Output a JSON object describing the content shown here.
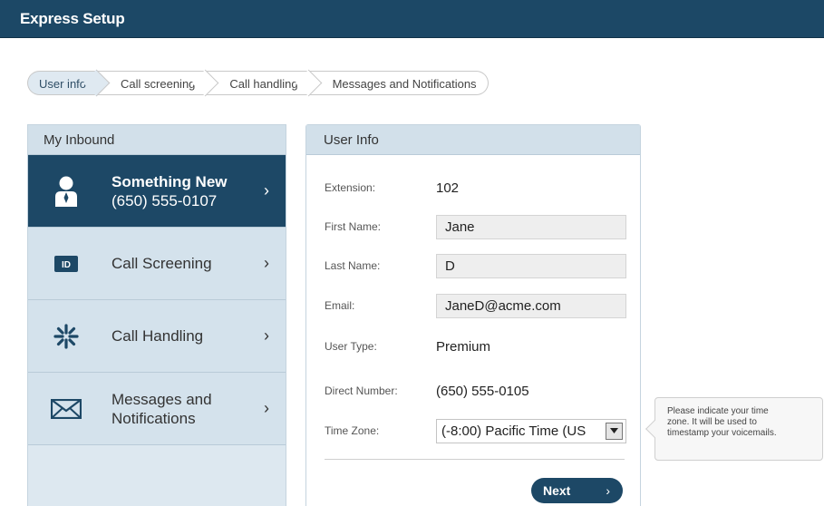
{
  "window": {
    "title": "Express Setup"
  },
  "breadcrumb": [
    {
      "label": "User info"
    },
    {
      "label": "Call screening"
    },
    {
      "label": "Call handling"
    },
    {
      "label": "Messages and Notifications"
    }
  ],
  "sidebar": {
    "title": "My Inbound",
    "items": [
      {
        "line1": "Something New",
        "line2": "(650) 555-0107",
        "icon": "user-icon",
        "active": true
      },
      {
        "line1": "Call Screening",
        "line2": "",
        "icon": "id-badge-icon",
        "active": false
      },
      {
        "line1": "Call Handling",
        "line2": "",
        "icon": "call-handling-icon",
        "active": false
      },
      {
        "line1": "Messages and",
        "line2": "Notifications",
        "icon": "envelope-icon",
        "active": false
      }
    ]
  },
  "user_info": {
    "title": "User Info",
    "extension_label": "Extension:",
    "extension": "102",
    "first_name_label": "First Name:",
    "first_name": "Jane",
    "last_name_label": "Last Name:",
    "last_name": "D",
    "email_label": "Email:",
    "email": "JaneD@acme.com",
    "user_type_label": "User Type:",
    "user_type": "Premium",
    "direct_number_label": "Direct Number:",
    "direct_number": "(650) 555-0105",
    "time_zone_label": "Time Zone:",
    "time_zone": "(-8:00) Pacific Time (US",
    "next_label": "Next"
  },
  "tooltip": {
    "line1": "Please indicate your time",
    "line2": "zone. It will be used to",
    "line3": "timestamp your voicemails."
  },
  "colors": {
    "header": "#1c4866",
    "active_nav": "#1d4866",
    "panel": "#dde8f0"
  }
}
